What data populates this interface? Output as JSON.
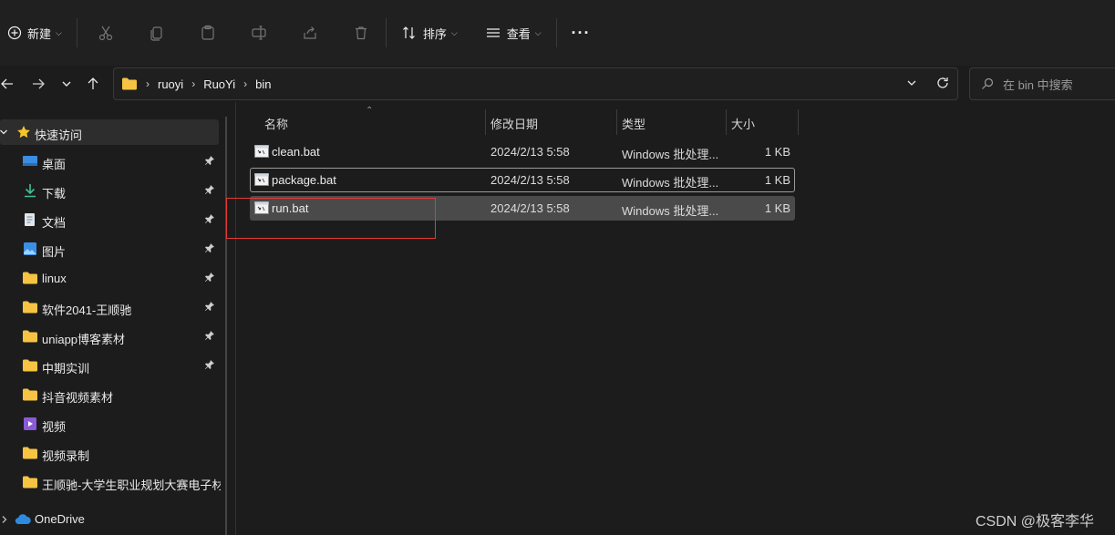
{
  "toolbar": {
    "new_label": "新建",
    "sort_label": "排序",
    "view_label": "查看",
    "more_label": "···"
  },
  "address": {
    "crumbs": [
      "ruoyi",
      "RuoYi",
      "bin"
    ]
  },
  "search": {
    "placeholder": "在 bin 中搜索"
  },
  "sidebar": {
    "quick_access": "快速访问",
    "items": [
      {
        "label": "桌面",
        "icon": "desktop-icon",
        "pinned": true
      },
      {
        "label": "下载",
        "icon": "download-icon",
        "pinned": true
      },
      {
        "label": "文档",
        "icon": "document-icon",
        "pinned": true
      },
      {
        "label": "图片",
        "icon": "picture-icon",
        "pinned": true
      },
      {
        "label": "linux",
        "icon": "folder-icon",
        "pinned": true
      },
      {
        "label": "软件2041-王顺驰",
        "icon": "folder-icon",
        "pinned": true
      },
      {
        "label": "uniapp博客素材",
        "icon": "folder-icon",
        "pinned": true
      },
      {
        "label": "中期实训",
        "icon": "folder-icon",
        "pinned": true
      },
      {
        "label": "抖音视频素材",
        "icon": "folder-icon",
        "pinned": false
      },
      {
        "label": "视频",
        "icon": "video-icon",
        "pinned": false
      },
      {
        "label": "视频录制",
        "icon": "folder-icon",
        "pinned": false
      },
      {
        "label": "王顺驰-大学生职业规划大赛电子材料",
        "icon": "folder-icon",
        "pinned": false
      }
    ],
    "onedrive": "OneDrive"
  },
  "columns": {
    "name": "名称",
    "date": "修改日期",
    "type": "类型",
    "size": "大小"
  },
  "files": [
    {
      "name": "clean.bat",
      "date": "2024/2/13 5:58",
      "type": "Windows 批处理...",
      "size": "1 KB"
    },
    {
      "name": "package.bat",
      "date": "2024/2/13 5:58",
      "type": "Windows 批处理...",
      "size": "1 KB"
    },
    {
      "name": "run.bat",
      "date": "2024/2/13 5:58",
      "type": "Windows 批处理...",
      "size": "1 KB"
    }
  ],
  "watermark": "CSDN @极客李华",
  "colors": {
    "highlight_box": "#e53935",
    "folder": "#f6c343",
    "selected_row": "#4a4a4a"
  }
}
